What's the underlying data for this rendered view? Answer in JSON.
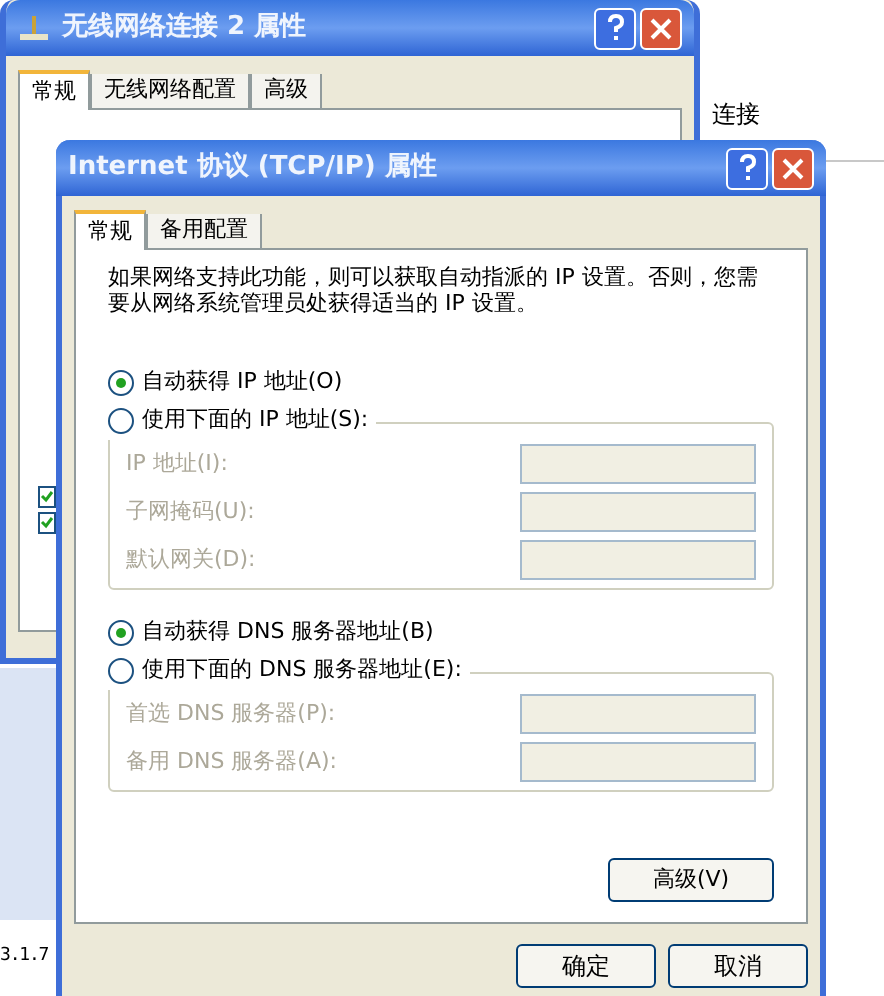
{
  "desktop": {
    "right_label": "连接",
    "bottom_label": "3.1.7"
  },
  "back_window": {
    "title": "无线网络连接 2 属性",
    "tabs": [
      {
        "label": "常规",
        "selected": true
      },
      {
        "label": "无线网络配置",
        "selected": false
      },
      {
        "label": "高级",
        "selected": false
      }
    ],
    "checkboxes": [
      {
        "checked": true
      },
      {
        "checked": true
      }
    ]
  },
  "dialog": {
    "title": "Internet 协议 (TCP/IP) 属性",
    "tabs": [
      {
        "label": "常规",
        "selected": true
      },
      {
        "label": "备用配置",
        "selected": false
      }
    ],
    "description": "如果网络支持此功能，则可以获取自动指派的 IP 设置。否则，您需要从网络系统管理员处获得适当的 IP 设置。",
    "groups": [
      {
        "options": [
          {
            "label": "自动获得 IP 地址(O)",
            "selected": true
          },
          {
            "label": "使用下面的 IP 地址(S):",
            "selected": false
          }
        ],
        "fields": [
          {
            "label": "IP 地址(I):",
            "disabled": true
          },
          {
            "label": "子网掩码(U):",
            "disabled": true
          },
          {
            "label": "默认网关(D):",
            "disabled": true
          }
        ]
      },
      {
        "options": [
          {
            "label": "自动获得 DNS 服务器地址(B)",
            "selected": true
          },
          {
            "label": "使用下面的 DNS 服务器地址(E):",
            "selected": false
          }
        ],
        "fields": [
          {
            "label": "首选 DNS 服务器(P):",
            "disabled": true
          },
          {
            "label": "备用 DNS 服务器(A):",
            "disabled": true
          }
        ]
      }
    ],
    "advanced_button": "高级(V)",
    "buttons": [
      "确定",
      "取消"
    ]
  }
}
